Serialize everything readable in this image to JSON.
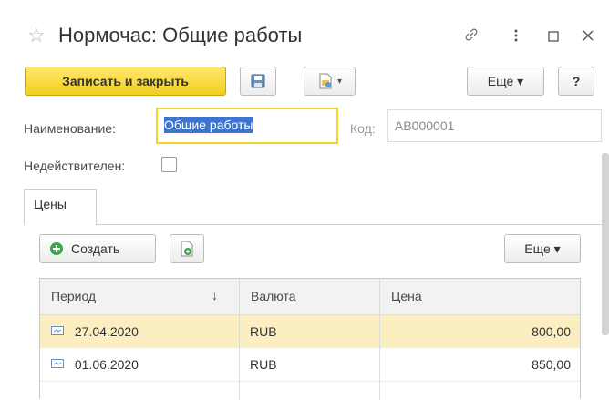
{
  "window": {
    "title": "Нормочас: Общие работы",
    "link_icon": "link-icon",
    "menu_icon": "more-vertical-icon",
    "maximize_icon": "maximize-icon",
    "close_icon": "close-icon"
  },
  "toolbar": {
    "save_close_label": "Записать и закрыть",
    "save_icon": "floppy-disk-icon",
    "report_icon": "document-report-icon",
    "more_label": "Еще ▾",
    "help_label": "?"
  },
  "form": {
    "name_label": "Наименование:",
    "name_value": "Общие работы",
    "code_label": "Код:",
    "code_value": "АВ000001",
    "invalid_label": "Недействителен:"
  },
  "tabs": [
    {
      "label": "Цены"
    }
  ],
  "prices": {
    "create_label": "Создать",
    "more_label": "Еще ▾",
    "columns": [
      "Период",
      "Валюта",
      "Цена"
    ],
    "sort_indicator": "↓",
    "rows": [
      {
        "period": "27.04.2020",
        "currency": "RUB",
        "price": "800,00",
        "selected": true
      },
      {
        "period": "01.06.2020",
        "currency": "RUB",
        "price": "850,00",
        "selected": false
      }
    ]
  },
  "colors": {
    "accent_yellow": "#f5d327",
    "selected_row": "#fbefc2",
    "selection_highlight": "#3d74cf"
  }
}
